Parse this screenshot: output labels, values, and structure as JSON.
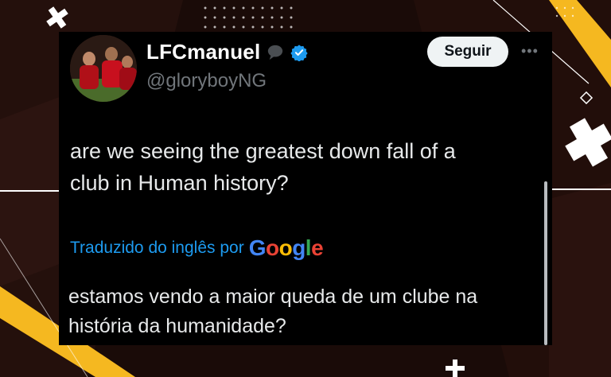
{
  "tweet": {
    "display_name": "LFCmanuel",
    "handle": "@gloryboyNG",
    "follow_label": "Seguir",
    "more_icon": "more-icon",
    "text_line1": "are we seeing the greatest down fall of a",
    "text_line2": "club in Human history?",
    "translated_by": "Traduzido do inglês por",
    "translation_provider": [
      "G",
      "o",
      "o",
      "g",
      "l",
      "e"
    ],
    "translation_line1": "estamos vendo a maior queda de um clube na",
    "translation_line2": "história da humanidade?"
  },
  "colors": {
    "background": "#1a0b08",
    "accent_yellow": "#f5b820",
    "verified_blue": "#1d9bf0",
    "link_blue": "#1d9bf0",
    "google_blue": "#4285f4",
    "google_red": "#ea4335",
    "google_yellow": "#fbbc05",
    "google_green": "#34a853"
  }
}
